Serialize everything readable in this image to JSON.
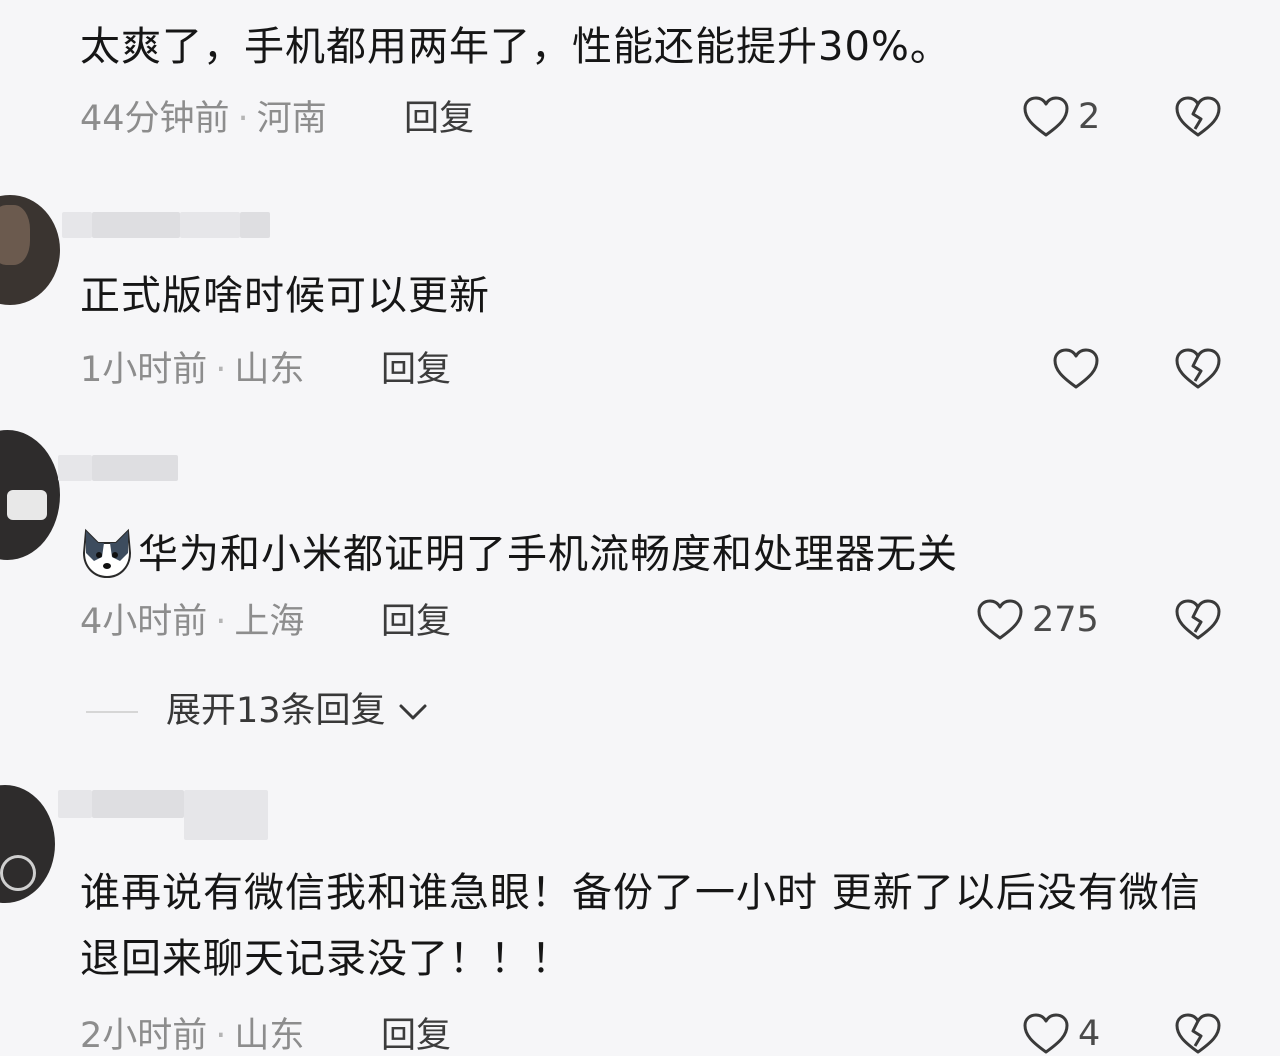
{
  "comments": [
    {
      "text": "太爽了，手机都用两年了，性能还能提升30%。",
      "time": "44分钟前",
      "location": "河南",
      "reply_label": "回复",
      "like_count": "2"
    },
    {
      "text": "正式版啥时候可以更新",
      "time": "1小时前",
      "location": "山东",
      "reply_label": "回复",
      "like_count": ""
    },
    {
      "text": "华为和小米都证明了手机流畅度和处理器无关",
      "time": "4小时前",
      "location": "上海",
      "reply_label": "回复",
      "like_count": "275",
      "expand_label": "展开13条回复"
    },
    {
      "text": "谁再说有微信我和谁急眼！备份了一小时 更新了以后没有微信 退回来聊天记录没了！！！",
      "time": "2小时前",
      "location": "山东",
      "reply_label": "回复",
      "like_count": "4"
    }
  ],
  "separator": "·",
  "icons": {
    "like": "heart-outline-icon",
    "dislike": "broken-heart-icon",
    "expand": "chevron-down-icon",
    "emoji": "husky-face-emoji-icon"
  },
  "colors": {
    "background": "#f6f6f8",
    "text": "#161616",
    "meta": "#8d8d8d"
  }
}
